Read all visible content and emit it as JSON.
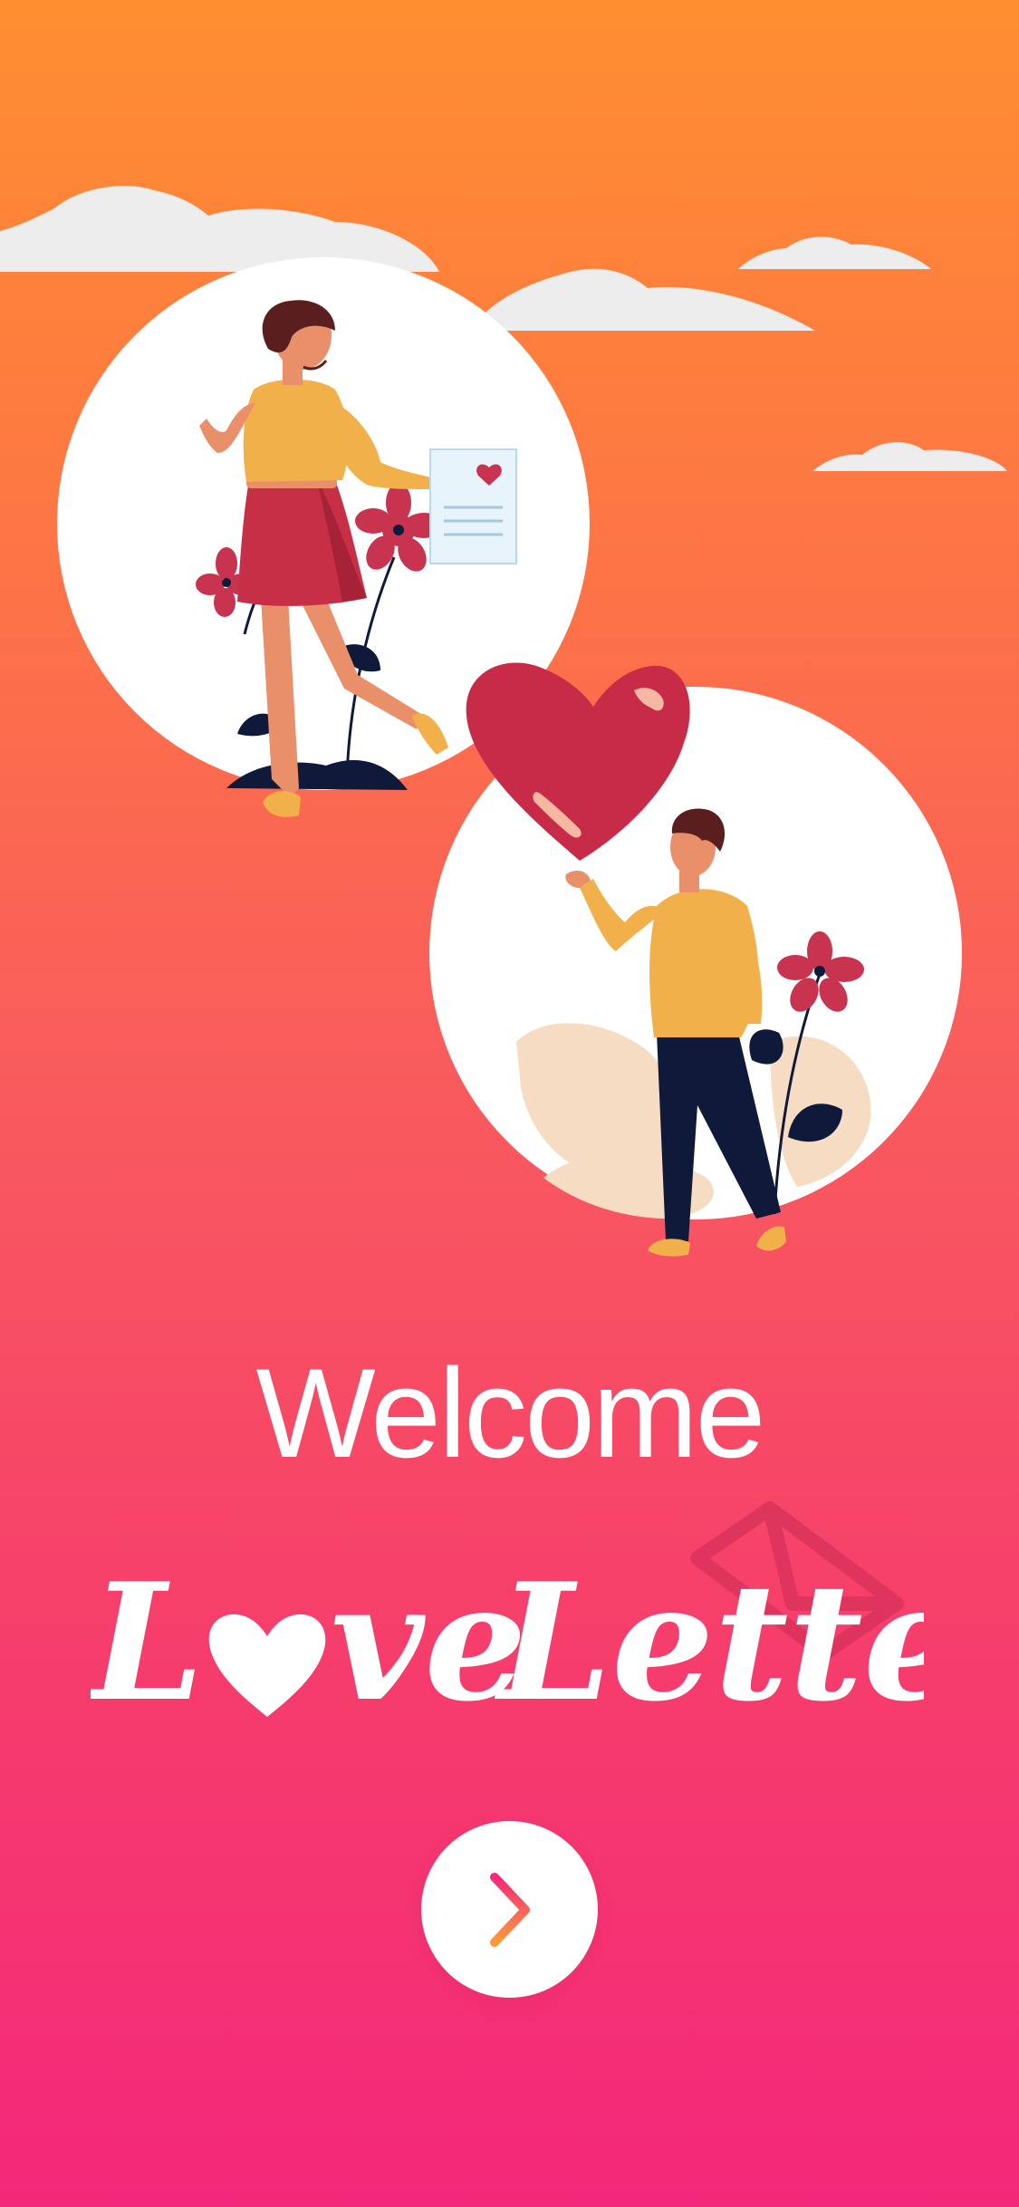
{
  "onboarding": {
    "welcome_title": "Welcome",
    "logo_text_part1": "L",
    "logo_text_part2": "ve",
    "logo_text_word2": "Letter",
    "next_button_icon": "chevron-right-icon"
  },
  "colors": {
    "gradient_top": "#FF8C33",
    "gradient_mid": "#FA5A5E",
    "gradient_bottom": "#F4297A",
    "heart": "#C82B47",
    "shirt": "#F2B04A",
    "skirt": "#C62F45",
    "pants": "#0F1A3A",
    "flower": "#C8334F",
    "white": "#FFFFFF"
  }
}
